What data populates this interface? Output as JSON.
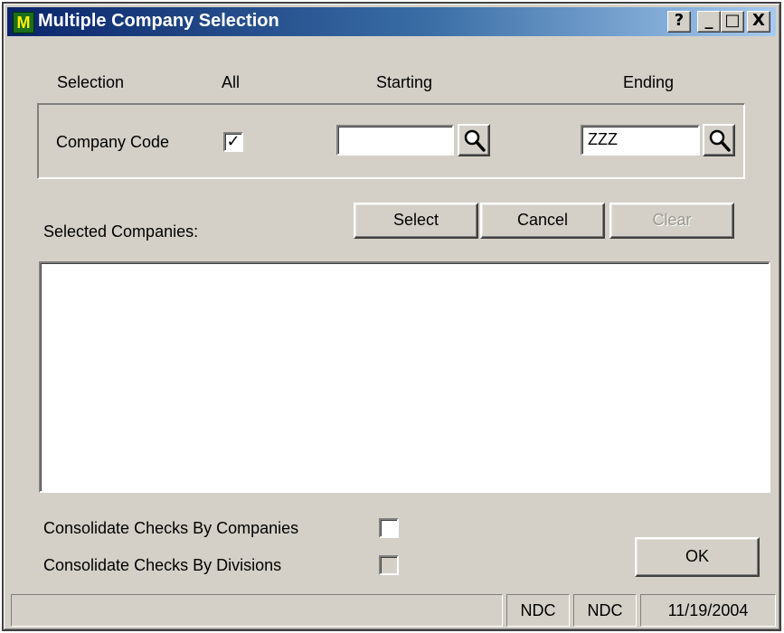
{
  "window": {
    "title": "Multiple Company Selection",
    "app_icon_glyph": "M",
    "controls": [
      "?",
      "_",
      "□",
      "X"
    ]
  },
  "headers": {
    "selection": "Selection",
    "all": "All",
    "starting": "Starting",
    "ending": "Ending"
  },
  "company_code": {
    "label": "Company Code",
    "all_checked": true,
    "all_check_glyph": "✓",
    "starting_value": "",
    "ending_value": "ZZZ"
  },
  "selected_companies": {
    "label": "Selected Companies:",
    "items": []
  },
  "buttons": {
    "select": "Select",
    "cancel": "Cancel",
    "clear": "Clear",
    "ok": "OK"
  },
  "options": {
    "consolidate_companies": {
      "label": "Consolidate Checks By Companies",
      "checked": false
    },
    "consolidate_divisions": {
      "label": "Consolidate Checks By Divisions",
      "checked": false,
      "disabled": true
    }
  },
  "statusbar": {
    "message": "",
    "panel_1": "NDC",
    "panel_2": "NDC",
    "date": "11/19/2004"
  },
  "colors": {
    "face": "#d4d0c8",
    "title_start": "#0a246a",
    "title_end": "#a6caf0"
  }
}
